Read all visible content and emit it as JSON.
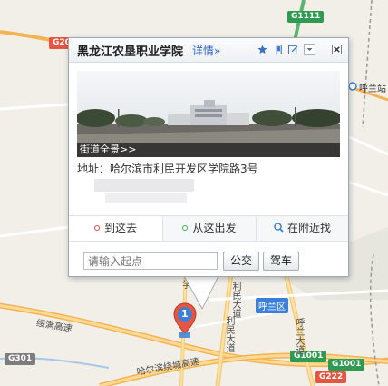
{
  "map": {
    "shields": {
      "g1111": "G1111",
      "g202": "G202",
      "g301": "G301",
      "g1001a": "G1001",
      "g1001b": "G1001",
      "g222": "G222"
    },
    "places": {
      "hulan_station": "呼兰站",
      "hulan_district": "呼兰区"
    },
    "roads": {
      "expressway": "绥满高速",
      "ring": "哈尔滨绕城高速",
      "ave1": "利民大道",
      "ave2": "利民大道",
      "ave3": "呼兰大道",
      "partial": "学"
    },
    "marker_number": "1"
  },
  "popup": {
    "title": "黑龙江农垦职业学院",
    "detail_link": "详情»",
    "icons": [
      "star-icon",
      "phone-icon",
      "edit-icon",
      "dropdown-icon",
      "close-icon"
    ],
    "photo_caption": "街道全景>>",
    "address_label": "地址：",
    "address_value": "哈尔滨市利民开发区学院路3号",
    "tabs": [
      {
        "label": "到这去",
        "dot_color": "#e2484a"
      },
      {
        "label": "从这出发",
        "dot_color": "#3fae50"
      },
      {
        "label": "在附近找",
        "dot_color": "#3b7fd6"
      }
    ],
    "search": {
      "placeholder": "请输入起点",
      "bus_button": "公交",
      "drive_button": "驾车"
    }
  }
}
